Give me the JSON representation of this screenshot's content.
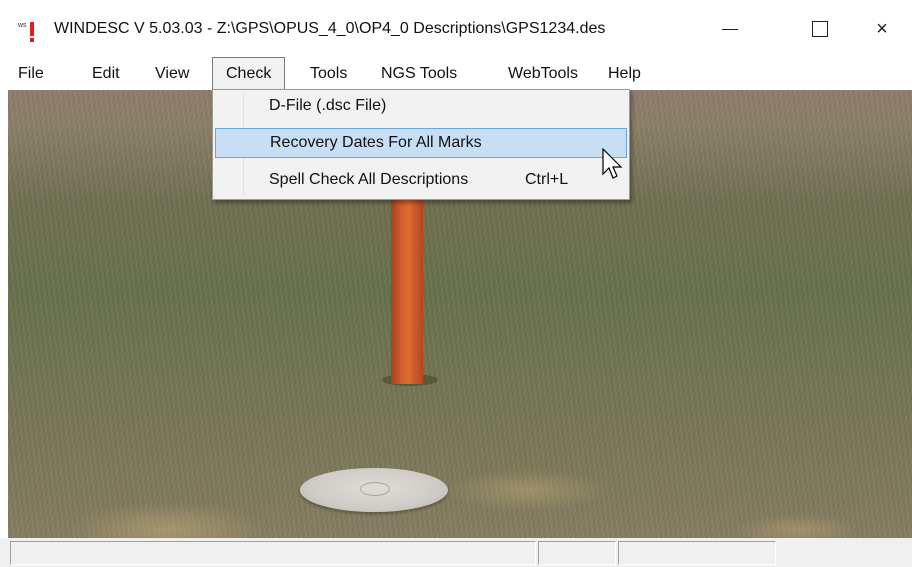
{
  "window": {
    "title": "WINDESC V 5.03.03 - Z:\\GPS\\OPUS_4_0\\OP4_0 Descriptions\\GPS1234.des",
    "icon": "ws-exclamation-icon",
    "controls": {
      "minimize": "minimize-icon",
      "maximize": "maximize-icon",
      "close": "×"
    }
  },
  "menubar": {
    "items": [
      {
        "label": "File"
      },
      {
        "label": "Edit"
      },
      {
        "label": "View"
      },
      {
        "label": "Check",
        "active": true
      },
      {
        "label": "Tools"
      },
      {
        "label": "NGS Tools"
      },
      {
        "label": "WebTools"
      },
      {
        "label": "Help"
      }
    ]
  },
  "check_menu": {
    "items": [
      {
        "label": "D-File (.dsc File)",
        "shortcut": ""
      },
      {
        "label": "Recovery Dates For All Marks",
        "shortcut": "",
        "highlighted": true
      },
      {
        "label": "Spell Check All Descriptions",
        "shortcut": "Ctrl+L"
      }
    ]
  },
  "content": {
    "image": "survey-mark-photo"
  },
  "statusbar": {
    "panes": [
      "",
      "",
      ""
    ]
  },
  "colors": {
    "highlight": "#c6dff5",
    "highlight_border": "#6aa6d8",
    "menu_bg": "#f2f2f2",
    "pole": "#d4602c"
  }
}
